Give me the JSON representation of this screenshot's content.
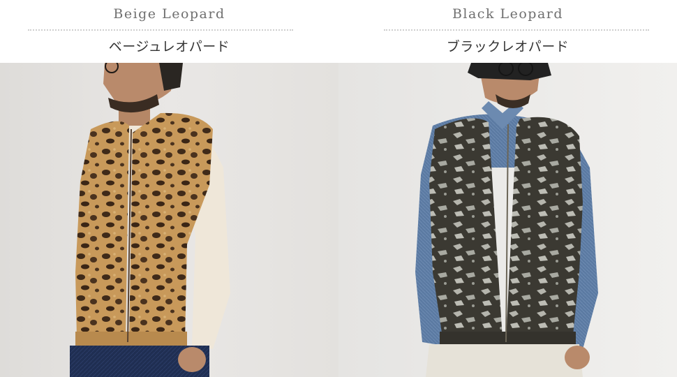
{
  "products": [
    {
      "name_en": "Beige Leopard",
      "name_jp": "ベージュレオパード",
      "colors": {
        "background": "#e7e5e3",
        "vest": "#c89a5c",
        "spots": "#4a3320",
        "inner": "#efe8db",
        "jeans": "#1f2e52",
        "skin": "#b9896a"
      }
    },
    {
      "name_en": "Black Leopard",
      "name_jp": "ブラックレオパード",
      "colors": {
        "background": "#ededeb",
        "vest": "#3c3a33",
        "spots": "#b8b8b0",
        "inner": "#5f7fa6",
        "pants": "#e6e2d8",
        "hat": "#222222",
        "skin": "#b9896a"
      }
    }
  ]
}
